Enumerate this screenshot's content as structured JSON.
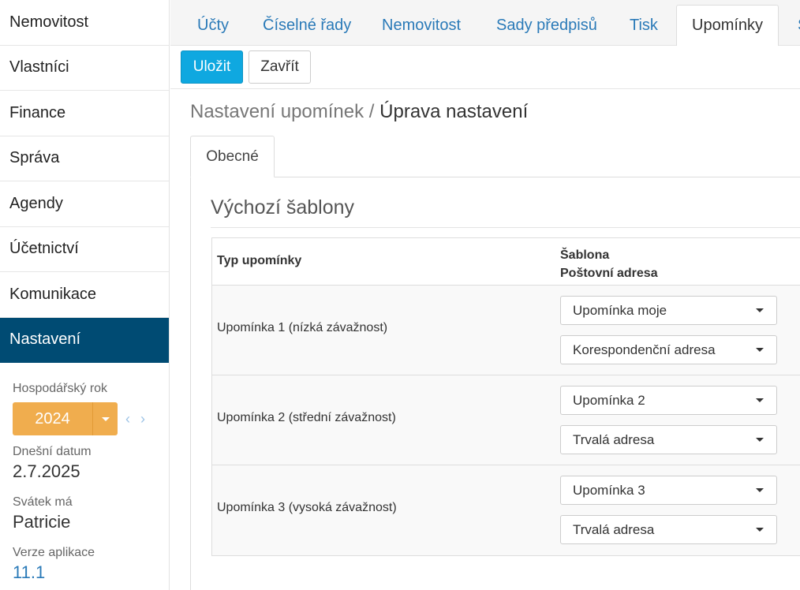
{
  "sidebar": {
    "items": [
      {
        "label": "Nemovitost",
        "active": false
      },
      {
        "label": "Vlastníci",
        "active": false
      },
      {
        "label": "Finance",
        "active": false
      },
      {
        "label": "Správa",
        "active": false
      },
      {
        "label": "Agendy",
        "active": false
      },
      {
        "label": "Účetnictví",
        "active": false
      },
      {
        "label": "Komunikace",
        "active": false
      },
      {
        "label": "Nastavení",
        "active": true
      }
    ],
    "fiscal_year_label": "Hospodářský rok",
    "fiscal_year": "2024",
    "prev_next": "‹ ›",
    "today_label": "Dnešní datum",
    "today": "2.7.2025",
    "nameday_label": "Svátek má",
    "nameday": "Patricie",
    "version_label": "Verze aplikace",
    "version": "11.1"
  },
  "top_tabs": [
    {
      "label": "Účty"
    },
    {
      "label": "Číselné řady"
    },
    {
      "label": "Nemovitost"
    },
    {
      "label": "Sady předpisů"
    },
    {
      "label": "Tisk"
    },
    {
      "label": "Upomínky"
    },
    {
      "label": "S"
    }
  ],
  "toolbar": {
    "save_label": "Uložit",
    "close_label": "Zavřít"
  },
  "breadcrumb": {
    "parent": "Nastavení upomínek",
    "separator": " / ",
    "current": "Úprava nastavení"
  },
  "subtab": {
    "label": "Obecné"
  },
  "section": {
    "title": "Výchozí šablony"
  },
  "table": {
    "col_type": "Typ upomínky",
    "col_template": "Šablona",
    "col_address": "Poštovní adresa",
    "rows": [
      {
        "type": "Upomínka 1 (nízká závažnost)",
        "template": "Upomínka moje",
        "address": "Korespondenční adresa"
      },
      {
        "type": "Upomínka 2 (střední závažnost)",
        "template": "Upomínka 2",
        "address": "Trvalá adresa"
      },
      {
        "type": "Upomínka 3 (vysoká závažnost)",
        "template": "Upomínka 3",
        "address": "Trvalá adresa"
      }
    ]
  },
  "colors": {
    "sidebar_active": "#004b73",
    "primary": "#0fa8e0",
    "year": "#f0ad4e",
    "link": "#2a7ab8"
  }
}
